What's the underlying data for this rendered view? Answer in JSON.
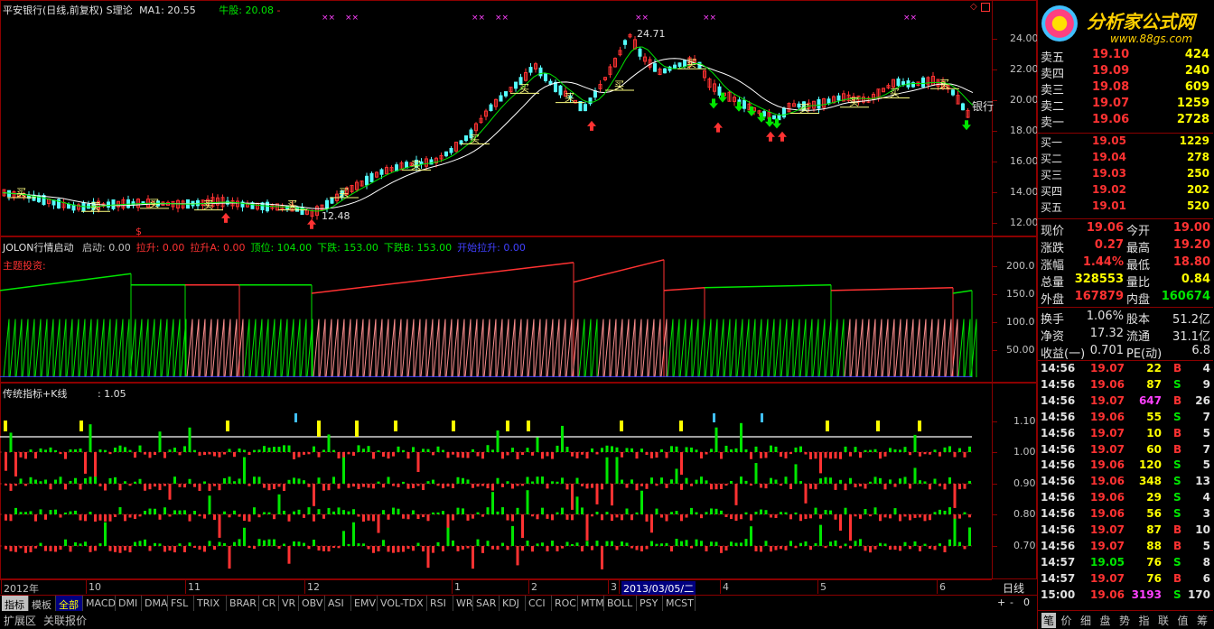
{
  "header": {
    "title": "平安银行(日线,前复权)",
    "theory": "S理论",
    "ma1_label": "MA1: 20.55",
    "bull_label": "牛股: 20.08",
    "bull_suffix": "-",
    "marks": "××"
  },
  "price_panel": {
    "y_ticks": [
      "24.00",
      "22.00",
      "20.00",
      "18.00",
      "16.00",
      "14.00",
      "12.00"
    ],
    "high_label": "24.71",
    "low_label": "12.48",
    "s_mark": "$",
    "stock_tag": "银行",
    "buy_label": "买"
  },
  "indicator1": {
    "title": "JOLON行情启动",
    "params": [
      {
        "label": "启动:",
        "value": "0.00",
        "color": "#c0c0c0"
      },
      {
        "label": "拉升:",
        "value": "0.00",
        "color": "#ff3232"
      },
      {
        "label": "拉升A:",
        "value": "0.00",
        "color": "#ff3232"
      },
      {
        "label": "顶位:",
        "value": "104.00",
        "color": "#00e600"
      },
      {
        "label": "下跌:",
        "value": "153.00",
        "color": "#00e600"
      },
      {
        "label": "下跌B:",
        "value": "153.00",
        "color": "#00e600"
      },
      {
        "label": "开始拉升:",
        "value": "0.00",
        "color": "#4040ff"
      }
    ],
    "subtitle": "主题投资:",
    "y_ticks": [
      "200.0",
      "150.0",
      "100.0",
      "50.00"
    ]
  },
  "indicator2": {
    "title": "传统指标+K线",
    "value": ": 1.05",
    "y_ticks": [
      "1.10",
      "1.00",
      "0.90",
      "0.80",
      "0.70"
    ]
  },
  "x_axis": {
    "labels": [
      "2012年",
      "10",
      "11",
      "12",
      "1",
      "2",
      "3",
      "2013/03/05/二",
      "4",
      "5",
      "6"
    ],
    "period": "日线"
  },
  "tabs": [
    "指标",
    "模板",
    "全部",
    "MACD",
    "DMI",
    "DMA",
    "FSL",
    "TRIX",
    "BRAR",
    "CR",
    "VR",
    "OBV",
    "ASI",
    "EMV",
    "VOL-TDX",
    "RSI",
    "WR",
    "SAR",
    "KDJ",
    "CCI",
    "ROC",
    "MTM",
    "BOLL",
    "PSY",
    "MCST"
  ],
  "zoom_controls": [
    "+",
    "-",
    "0"
  ],
  "bottom_tabs": [
    "扩展区",
    "关联报价"
  ],
  "logo": {
    "text": "分析家公式网",
    "url": "www.88gs.com"
  },
  "order_book": {
    "sell": [
      {
        "label": "卖五",
        "price": "19.10",
        "vol": "424"
      },
      {
        "label": "卖四",
        "price": "19.09",
        "vol": "240"
      },
      {
        "label": "卖三",
        "price": "19.08",
        "vol": "609"
      },
      {
        "label": "卖二",
        "price": "19.07",
        "vol": "1259"
      },
      {
        "label": "卖一",
        "price": "19.06",
        "vol": "2728"
      }
    ],
    "buy": [
      {
        "label": "买一",
        "price": "19.05",
        "vol": "1229"
      },
      {
        "label": "买二",
        "price": "19.04",
        "vol": "278"
      },
      {
        "label": "买三",
        "price": "19.03",
        "vol": "250"
      },
      {
        "label": "买四",
        "price": "19.02",
        "vol": "202"
      },
      {
        "label": "买五",
        "price": "19.01",
        "vol": "520"
      }
    ]
  },
  "quote": [
    {
      "l1": "现价",
      "v1": "19.06",
      "c1": "#ff3232",
      "l2": "今开",
      "v2": "19.00",
      "c2": "#ff3232"
    },
    {
      "l1": "涨跌",
      "v1": "0.27",
      "c1": "#ff3232",
      "l2": "最高",
      "v2": "19.20",
      "c2": "#ff3232"
    },
    {
      "l1": "涨幅",
      "v1": "1.44%",
      "c1": "#ff3232",
      "l2": "最低",
      "v2": "18.80",
      "c2": "#ff3232"
    },
    {
      "l1": "总量",
      "v1": "328553",
      "c1": "#ffff00",
      "l2": "量比",
      "v2": "0.84",
      "c2": "#ffff00"
    },
    {
      "l1": "外盘",
      "v1": "167879",
      "c1": "#ff3232",
      "l2": "内盘",
      "v2": "160674",
      "c2": "#00e600"
    }
  ],
  "stats": [
    {
      "l1": "换手",
      "v1": "1.06%",
      "l2": "股本",
      "v2": "51.2亿"
    },
    {
      "l1": "净资",
      "v1": "17.32",
      "l2": "流通",
      "v2": "31.1亿"
    },
    {
      "l1": "收益(一)",
      "v1": "0.701",
      "l2": "PE(动)",
      "v2": "6.8"
    }
  ],
  "trades": [
    {
      "t": "14:56",
      "p": "19.07",
      "v": "22",
      "s": "B",
      "n": "4",
      "vc": "#ffff00"
    },
    {
      "t": "14:56",
      "p": "19.06",
      "v": "87",
      "s": "S",
      "n": "9",
      "vc": "#ffff00"
    },
    {
      "t": "14:56",
      "p": "19.07",
      "v": "647",
      "s": "B",
      "n": "26",
      "vc": "#ff40ff"
    },
    {
      "t": "14:56",
      "p": "19.06",
      "v": "55",
      "s": "S",
      "n": "7",
      "vc": "#ffff00"
    },
    {
      "t": "14:56",
      "p": "19.07",
      "v": "10",
      "s": "B",
      "n": "5",
      "vc": "#ffff00"
    },
    {
      "t": "14:56",
      "p": "19.07",
      "v": "60",
      "s": "B",
      "n": "7",
      "vc": "#ffff00"
    },
    {
      "t": "14:56",
      "p": "19.06",
      "v": "120",
      "s": "S",
      "n": "5",
      "vc": "#ffff00"
    },
    {
      "t": "14:56",
      "p": "19.06",
      "v": "348",
      "s": "S",
      "n": "13",
      "vc": "#ffff00"
    },
    {
      "t": "14:56",
      "p": "19.06",
      "v": "29",
      "s": "S",
      "n": "4",
      "vc": "#ffff00"
    },
    {
      "t": "14:56",
      "p": "19.06",
      "v": "56",
      "s": "S",
      "n": "3",
      "vc": "#ffff00"
    },
    {
      "t": "14:56",
      "p": "19.07",
      "v": "87",
      "s": "B",
      "n": "10",
      "vc": "#ffff00"
    },
    {
      "t": "14:56",
      "p": "19.07",
      "v": "88",
      "s": "B",
      "n": "5",
      "vc": "#ffff00"
    },
    {
      "t": "14:57",
      "p": "19.05",
      "v": "76",
      "s": "S",
      "n": "8",
      "vc": "#ffff00"
    },
    {
      "t": "14:57",
      "p": "19.07",
      "v": "76",
      "s": "B",
      "n": "6",
      "vc": "#ffff00"
    },
    {
      "t": "15:00",
      "p": "19.06",
      "v": "3193",
      "s": "S",
      "n": "170",
      "vc": "#ff40ff"
    }
  ],
  "right_tabs": [
    "笔",
    "价",
    "细",
    "盘",
    "势",
    "指",
    "联",
    "值",
    "筹"
  ],
  "colors": {
    "up": "#ff3232",
    "down": "#00e600",
    "ma": "#ffffff",
    "bull": "#00e600",
    "grid": "#8b0000"
  }
}
